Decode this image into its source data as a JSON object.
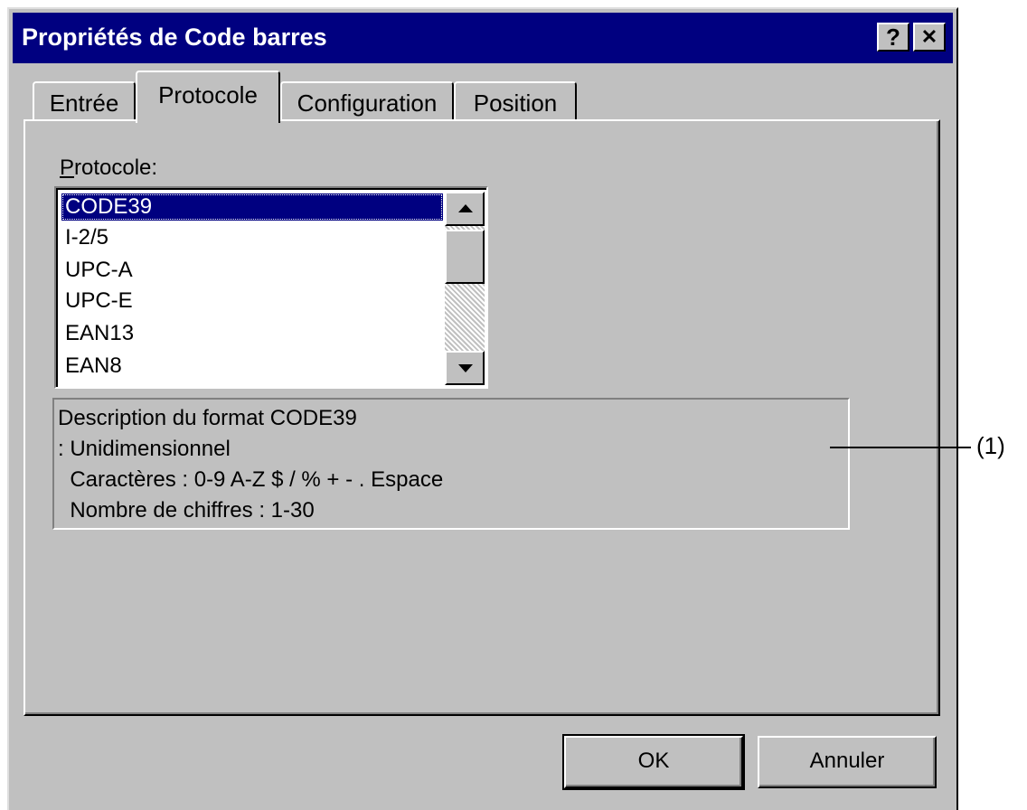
{
  "window": {
    "title": "Propriétés de Code barres",
    "help_glyph": "?",
    "close_glyph": "✕"
  },
  "tabs": [
    {
      "label": "Entrée",
      "active": false
    },
    {
      "label": "Protocole",
      "active": true
    },
    {
      "label": "Configuration",
      "active": false
    },
    {
      "label": "Position",
      "active": false
    }
  ],
  "protocol": {
    "label_mnemonic": "P",
    "label_rest": "rotocole:",
    "items": [
      "CODE39",
      "I-2/5",
      "UPC-A",
      "UPC-E",
      "EAN13",
      "EAN8"
    ],
    "selected": "CODE39"
  },
  "description": {
    "lines": [
      "Description du format CODE39",
      ": Unidimensionnel",
      "  Caractères : 0-9 A-Z $ / % + - . Espace",
      "  Nombre de chiffres : 1-30"
    ]
  },
  "callout": {
    "label": "(1)"
  },
  "buttons": {
    "ok": "OK",
    "cancel": "Annuler"
  }
}
